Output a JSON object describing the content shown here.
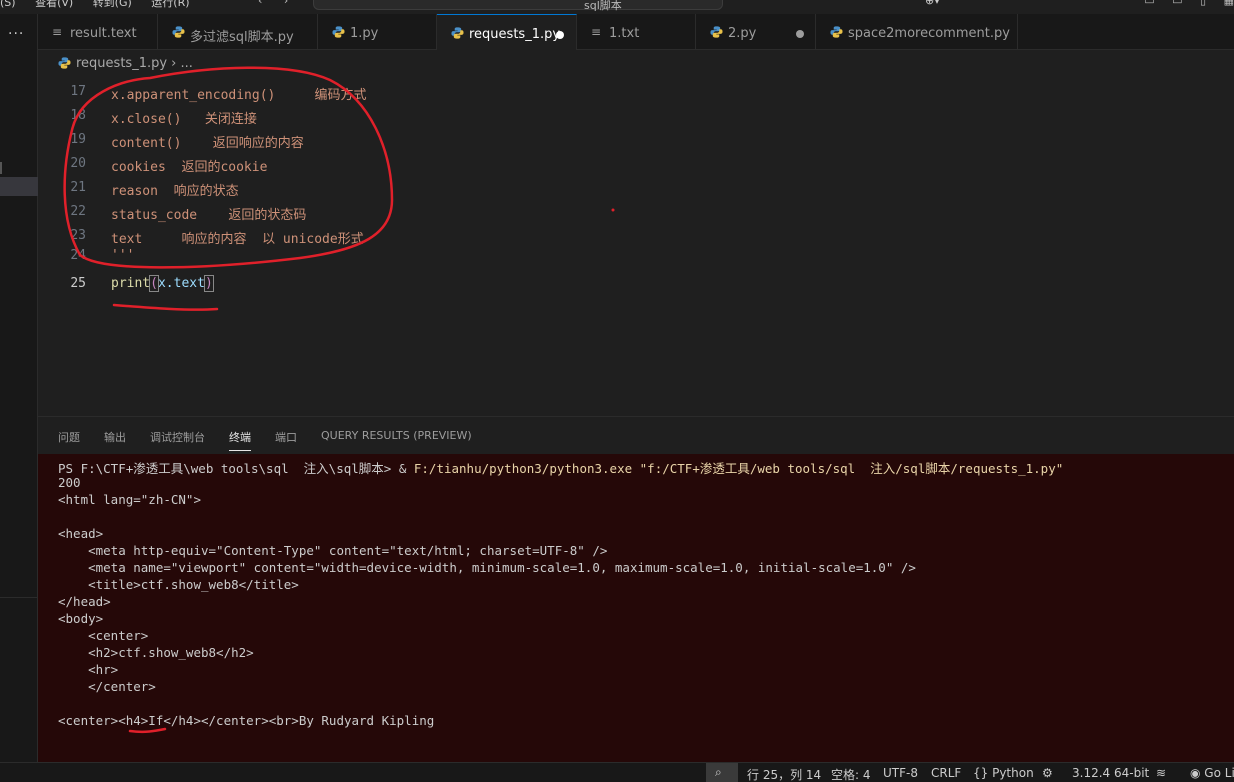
{
  "menu": {
    "items": [
      "(S)",
      "查看(V)",
      "转到(G)",
      "运行(R)"
    ]
  },
  "nav": {
    "back": "‹",
    "forward": "›"
  },
  "command_center": {
    "text": "sql脚本"
  },
  "tabs": [
    {
      "label": "result.text",
      "icon": "lines-icon"
    },
    {
      "label": "多过滤sql脚本.py",
      "icon": "python-icon"
    },
    {
      "label": "1.py",
      "icon": "python-icon"
    },
    {
      "label": "requests_1.py",
      "icon": "python-icon",
      "active": true,
      "modified": true
    },
    {
      "label": "1.txt",
      "icon": "lines-icon"
    },
    {
      "label": "2.py",
      "icon": "python-icon",
      "modified": true
    },
    {
      "label": "space2morecomment.py",
      "icon": "python-icon"
    }
  ],
  "breadcrumb": {
    "file": "requests_1.py",
    "sep": " › ..."
  },
  "editor": {
    "lines": [
      {
        "num": "17",
        "text": "x.apparent_encoding()     编码方式"
      },
      {
        "num": "18",
        "text": "x.close()   关闭连接"
      },
      {
        "num": "19",
        "text": "content()    返回响应的内容"
      },
      {
        "num": "20",
        "text": "cookies  返回的cookie"
      },
      {
        "num": "21",
        "text": "reason  响应的状态"
      },
      {
        "num": "22",
        "text": "status_code    返回的状态码"
      },
      {
        "num": "23",
        "text": "text     响应的内容  以 unicode形式"
      },
      {
        "num": "24",
        "text": "'''"
      }
    ],
    "current": {
      "num": "25",
      "fn": "print",
      "open": "(",
      "arg": "x.text",
      "close": ")"
    }
  },
  "panel": {
    "tabs": [
      "问题",
      "输出",
      "调试控制台",
      "终端",
      "端口",
      "QUERY RESULTS (PREVIEW)"
    ],
    "active_tab": "终端"
  },
  "terminal": {
    "prompt": "PS F:\\CTF+渗透工具\\web tools\\sql  注入\\sql脚本> & ",
    "command": "F:/tianhu/python3/python3.exe \"f:/CTF+渗透工具/web tools/sql  注入/sql脚本/requests_1.py\"",
    "output": [
      "200",
      "<html lang=\"zh-CN\">",
      "",
      "<head>",
      "    <meta http-equiv=\"Content-Type\" content=\"text/html; charset=UTF-8\" />",
      "    <meta name=\"viewport\" content=\"width=device-width, minimum-scale=1.0, maximum-scale=1.0, initial-scale=1.0\" />",
      "    <title>ctf.show_web8</title>",
      "</head>",
      "<body>",
      "    <center>",
      "    <h2>ctf.show_web8</h2>",
      "    <hr>",
      "    </center>",
      "",
      "<center><h4>If</h4></center><br>By Rudyard Kipling"
    ]
  },
  "status": {
    "position": "行 25，列 14",
    "spaces": "空格: 4",
    "encoding": "UTF-8",
    "eol": "CRLF",
    "language": "{} Python",
    "interpreter": "3.12.4 64-bit",
    "golive": "Go Live"
  },
  "colors": {
    "accent": "#0078d4",
    "terminal_bg": "#250808",
    "annotation": "#e0202a"
  }
}
